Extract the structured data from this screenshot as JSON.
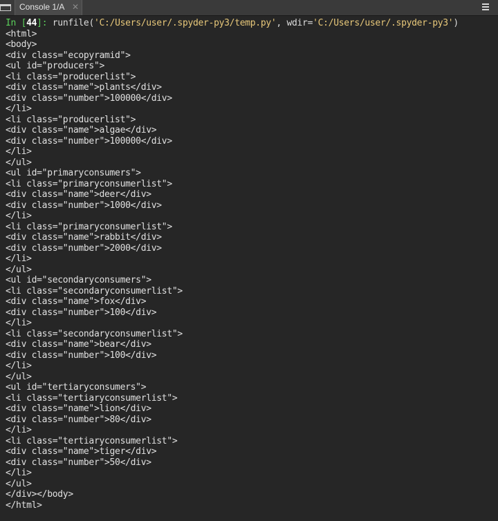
{
  "tab": {
    "title": "Console 1/A",
    "close_icon": "close-icon",
    "console_icon": "console-icon"
  },
  "options_icon": "options-menu-icon",
  "colors": {
    "background": "#262626",
    "prompt_green": "#5bd05b",
    "string_yellow": "#e8c87a",
    "text": "#e0e0e0"
  },
  "console": {
    "prompt_in": "In [",
    "prompt_number": "44",
    "prompt_close": "]: ",
    "command_call": "runfile(",
    "command_arg1": "'C:/Users/user/.spyder-py3/temp.py'",
    "command_sep": ", wdir=",
    "command_arg2": "'C:/Users/user/.spyder-py3'",
    "command_end": ")",
    "output_lines": [
      "<html>",
      "<body>",
      "<div class=\"ecopyramid\">",
      "<ul id=\"producers\">",
      "<li class=\"producerlist\">",
      "<div class=\"name\">plants</div>",
      "<div class=\"number\">100000</div>",
      "</li>",
      "<li class=\"producerlist\">",
      "<div class=\"name\">algae</div>",
      "<div class=\"number\">100000</div>",
      "</li>",
      "</ul>",
      "<ul id=\"primaryconsumers\">",
      "<li class=\"primaryconsumerlist\">",
      "<div class=\"name\">deer</div>",
      "<div class=\"number\">1000</div>",
      "</li>",
      "<li class=\"primaryconsumerlist\">",
      "<div class=\"name\">rabbit</div>",
      "<div class=\"number\">2000</div>",
      "</li>",
      "</ul>",
      "<ul id=\"secondaryconsumers\">",
      "<li class=\"secondaryconsumerlist\">",
      "<div class=\"name\">fox</div>",
      "<div class=\"number\">100</div>",
      "</li>",
      "<li class=\"secondaryconsumerlist\">",
      "<div class=\"name\">bear</div>",
      "<div class=\"number\">100</div>",
      "</li>",
      "</ul>",
      "<ul id=\"tertiaryconsumers\">",
      "<li class=\"tertiaryconsumerlist\">",
      "<div class=\"name\">lion</div>",
      "<div class=\"number\">80</div>",
      "</li>",
      "<li class=\"tertiaryconsumerlist\">",
      "<div class=\"name\">tiger</div>",
      "<div class=\"number\">50</div>",
      "</li>",
      "</ul>",
      "</div></body>",
      "</html>"
    ]
  }
}
